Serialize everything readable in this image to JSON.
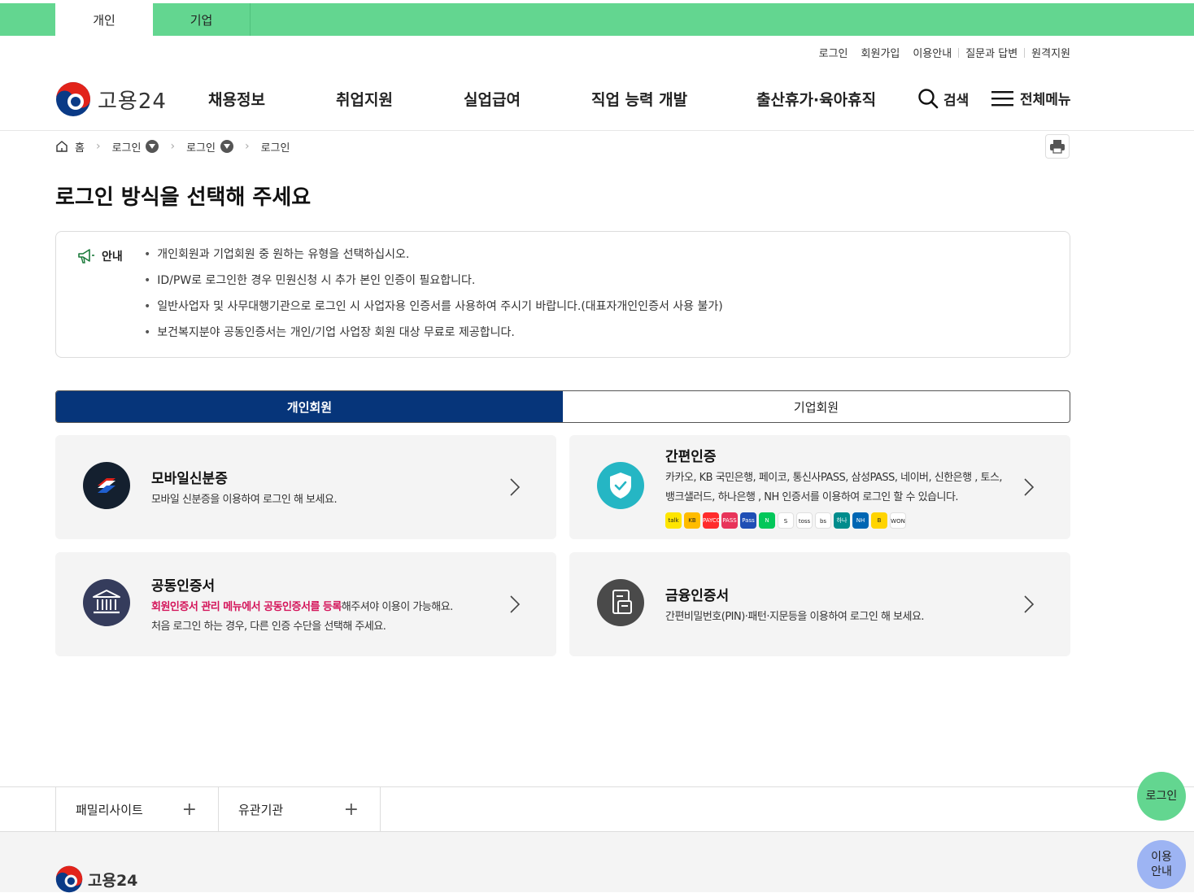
{
  "top_tabs": [
    "개인",
    "기업"
  ],
  "util_links": [
    "로그인",
    "회원가입",
    "이용안내",
    "질문과 답변",
    "원격지원"
  ],
  "logo_text": "고용24",
  "gnb": [
    "채용정보",
    "취업지원",
    "실업급여",
    "직업 능력 개발",
    "출산휴가·육아휴직"
  ],
  "search_label": "검색",
  "allmenu_label": "전체메뉴",
  "breadcrumb": [
    "홈",
    "로그인",
    "로그인",
    "로그인"
  ],
  "page_title": "로그인 방식을 선택해 주세요",
  "notice": {
    "label": "안내",
    "items": [
      "개인회원과 기업회원 중 원하는 유형을 선택하십시오.",
      "ID/PW로 로그인한 경우 민원신청 시 추가 본인 인증이 필요합니다.",
      "일반사업자 및 사무대행기관으로 로그인 시 사업자용 인증서를 사용하여 주시기 바랍니다.(대표자개인인증서 사용 불가)",
      "보건복지분야 공동인증서는 개인/기업 사업장 회원 대상 무료로 제공합니다."
    ]
  },
  "member_tabs": [
    "개인회원",
    "기업회원"
  ],
  "cards": {
    "mobile": {
      "title": "모바일신분증",
      "desc": "모바일 신분증을 이용하여 로그인 해 보세요."
    },
    "simple": {
      "title": "간편인증",
      "desc1": "카카오, KB 국민은행, 페이코, 통신사PASS, 삼성PASS, 네이버, 신한은행 , 토스,",
      "desc2": "뱅크샐러드, 하나은행 , NH 인증서를 이용하여 로그인 할 수 있습니다."
    },
    "joint": {
      "title": "공동인증서",
      "desc_red": "회원인증서 관리 메뉴에서 공동인증서를 등록",
      "desc_rest": "해주셔야 이용이 가능해요.",
      "desc2": "처음 로그인 하는 경우, 다른 인증 수단을 선택해 주세요."
    },
    "finance": {
      "title": "금융인증서",
      "desc": "간편비밀번호(PIN)·패턴·지문등을 이용하여 로그인 해 보세요."
    }
  },
  "provider_icons": [
    {
      "name": "kakao-icon",
      "color": "#fee500",
      "label": "talk"
    },
    {
      "name": "kb-icon",
      "color": "#ffbc00",
      "label": "KB"
    },
    {
      "name": "payco-icon",
      "color": "#ff2b2b",
      "label": "PAYCO"
    },
    {
      "name": "pass-icon",
      "color": "#e8345a",
      "label": "PASS"
    },
    {
      "name": "samsung-pass-icon",
      "color": "#1f4fb5",
      "label": "Pass"
    },
    {
      "name": "naver-icon",
      "color": "#03c75a",
      "label": "N"
    },
    {
      "name": "shinhan-icon",
      "color": "#ffffff",
      "label": "S"
    },
    {
      "name": "toss-icon",
      "color": "#ffffff",
      "label": "toss"
    },
    {
      "name": "banksalad-icon",
      "color": "#ffffff",
      "label": "bs"
    },
    {
      "name": "hana-icon",
      "color": "#008c8c",
      "label": "하나"
    },
    {
      "name": "nh-icon",
      "color": "#0066b3",
      "label": "NH"
    },
    {
      "name": "b-icon",
      "color": "#ffd400",
      "label": "B"
    },
    {
      "name": "woori-icon",
      "color": "#ffffff",
      "label": "WON"
    }
  ],
  "footer": {
    "family_site": "패밀리사이트",
    "related": "유관기관",
    "logo_text": "고용24"
  },
  "fab_login": "로그인",
  "fab_guide": "이용 안내",
  "colors": {
    "green": "#63d690",
    "navy": "#06357a",
    "red": "#d4145a"
  }
}
